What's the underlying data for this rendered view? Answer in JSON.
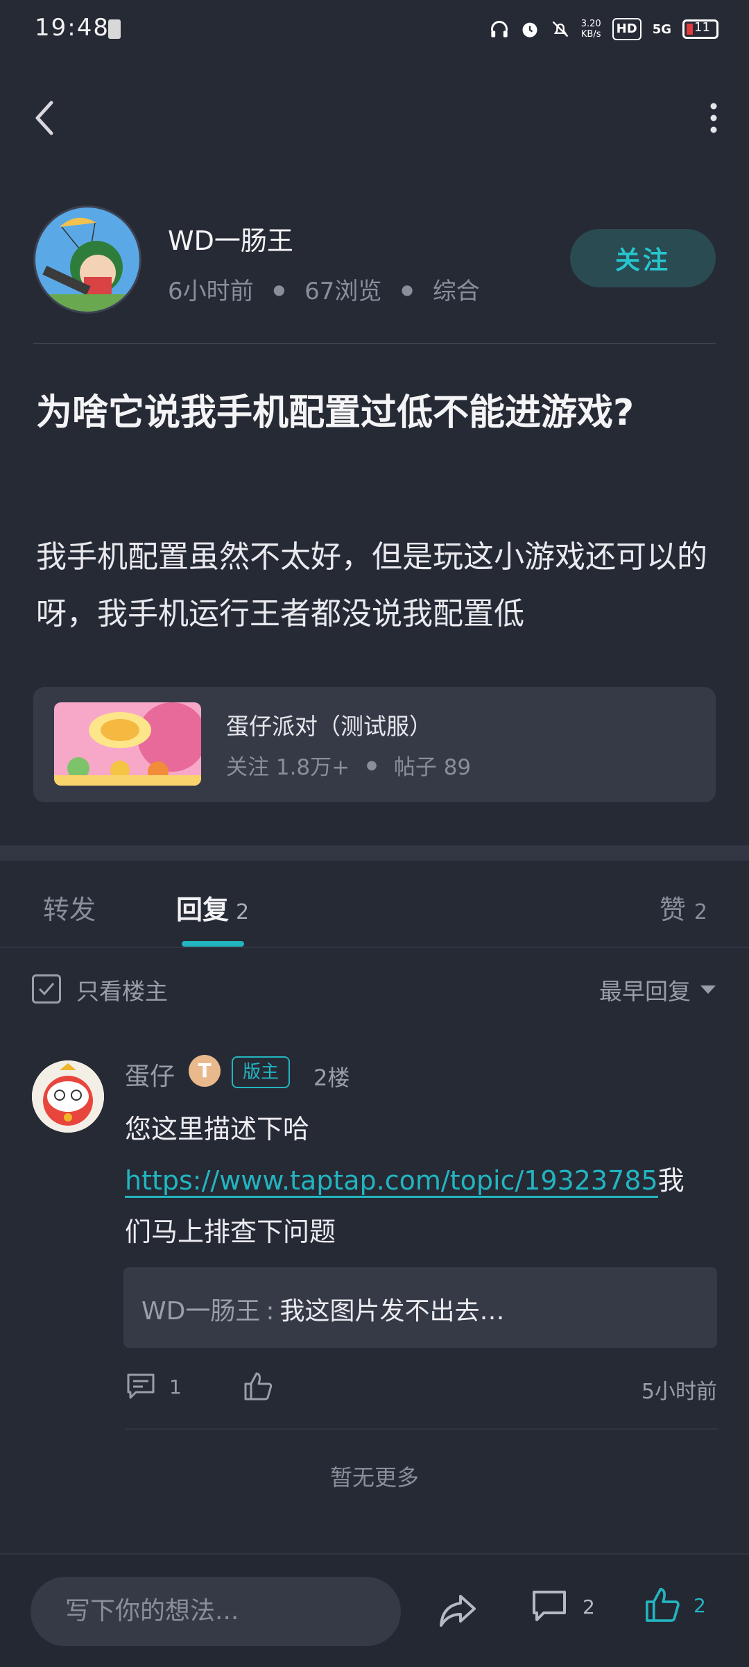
{
  "status_bar": {
    "time": "19:48",
    "network_speed": "3.20",
    "network_unit": "KB/s",
    "hd_label": "HD",
    "signal_label": "5G",
    "battery": "11",
    "battery_color": "#e23b3b"
  },
  "author": {
    "name": "WD一肠王",
    "time_ago": "6小时前",
    "views": "67浏览",
    "category": "综合",
    "follow_label": "关注"
  },
  "post": {
    "title": "为啥它说我手机配置过低不能进游戏?",
    "body": "我手机配置虽然不太好，但是玩这小游戏还可以的呀，我手机运行王者都没说我配置低"
  },
  "game": {
    "name": "蛋仔派对（测试服）",
    "followers": "关注 1.8万+",
    "posts": "帖子 89"
  },
  "tabs": {
    "repost": "转发",
    "reply": "回复",
    "reply_count": "2",
    "like": "赞",
    "like_count": "2"
  },
  "filter": {
    "only_op": "只看楼主",
    "sort": "最早回复"
  },
  "reply": {
    "name": "蛋仔",
    "badge_t": "T",
    "badge_mod": "版主",
    "floor": "2楼",
    "line1": "您这里描述下哈",
    "link": "https://www.taptap.com/topic/19323785",
    "after_link": "我们马上排查下问题",
    "quote_author": "WD一肠王",
    "quote_sep": ":",
    "quote_text": "我这图片发不出去…",
    "comment_count": "1",
    "time": "5小时前"
  },
  "no_more": "暂无更多",
  "bottom_bar": {
    "input_placeholder": "写下你的想法...",
    "comment_count": "2",
    "like_count": "2",
    "accent": "#22b5c0"
  }
}
